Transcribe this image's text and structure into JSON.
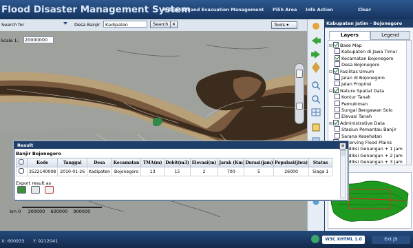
{
  "header": {
    "title": "Flood Disaster Management System",
    "nav": [
      {
        "label": "- Mitigation and Evacuation Management"
      },
      {
        "label": "Pilih Area"
      },
      {
        "label": "Info Action"
      },
      {
        "label": "Clear"
      }
    ]
  },
  "toolbar": {
    "search_label": "Search for",
    "layer_label": "Desa Banjir",
    "search_value": "Kadipaten",
    "search_button": "Search",
    "close_glyph": "✕",
    "tools_label": "Tools ▾"
  },
  "map": {
    "scale_label": "Scale 1:",
    "scale_value": "20000000",
    "km_label": "km 0",
    "km_ticks": [
      "300000",
      "600000",
      "900000"
    ]
  },
  "side_panel": {
    "title": "Kabupaten Jatim - Bojonegoro",
    "tabs": [
      {
        "label": "Layers"
      },
      {
        "label": "Legend"
      }
    ],
    "tree": [
      {
        "label": "Base Map",
        "level": 0,
        "checked": true
      },
      {
        "label": "Kabupaten di Jawa Timur",
        "level": 1,
        "checked": false
      },
      {
        "label": "Kecamatan Bojonegoro",
        "level": 1,
        "checked": true
      },
      {
        "label": "Desa Bojonegoro",
        "level": 1,
        "checked": false
      },
      {
        "label": "Fasilitas Umum",
        "level": 0,
        "checked": true
      },
      {
        "label": "Jalan di Bojonegoro",
        "level": 1,
        "checked": false
      },
      {
        "label": "Jalan Propinsi",
        "level": 1,
        "checked": false
      },
      {
        "label": "Nature Spatial Data",
        "level": 0,
        "checked": true
      },
      {
        "label": "Kontur Tanah",
        "level": 1,
        "checked": false
      },
      {
        "label": "Pemukiman",
        "level": 1,
        "checked": false
      },
      {
        "label": "Sungai Bengawan Solo",
        "level": 1,
        "checked": false
      },
      {
        "label": "Elevasi Tanah",
        "level": 1,
        "checked": false
      },
      {
        "label": "Administrative Data",
        "level": 0,
        "checked": true
      },
      {
        "label": "Stasiun Pemantau Banjir",
        "level": 1,
        "checked": false
      },
      {
        "label": "Sarana Kesehatan",
        "level": 1,
        "checked": false
      },
      {
        "label": "Preserving Flood Plains",
        "level": 0,
        "checked": true
      },
      {
        "label": "Prediksi Genangan + 1 Jam",
        "level": 1,
        "checked": false
      },
      {
        "label": "Prediksi Genangan + 2 Jam",
        "level": 1,
        "checked": false
      },
      {
        "label": "Prediksi Genangan + 3 Jam",
        "level": 1,
        "checked": false
      }
    ]
  },
  "result": {
    "title": "Result",
    "subtitle": "Banjir Bojonegoro",
    "columns": [
      "",
      "Kode",
      "Tanggal",
      "Desa",
      "Kecamatan",
      "TMA(m)",
      "Debit(m3)",
      "Elevasi(m)",
      "Jarak (Km)",
      "Durasi(jam)",
      "Populasi(jiwa)",
      "Status"
    ],
    "rows": [
      [
        "",
        "3522140008",
        "2010-01-26",
        "Kadipaten",
        "Bojonegoro",
        "13",
        "15",
        "2",
        "700",
        "5",
        "26000",
        "Siaga 1"
      ]
    ],
    "export_label": "Export result as"
  },
  "status_bar": {
    "x_coord": "X: 600933",
    "y_coord": "Y: 9212041",
    "badges": [
      "W3C XHTML 1.0",
      "Ext JS"
    ]
  },
  "colors": {
    "header_bg": "#1f3f68",
    "map_bg": "#9fa19c",
    "flood_dark": "#3c2c1e",
    "flood_mid": "#7a5a3e",
    "flood_light": "#b8a078",
    "minimap_green": "#1e9a1e"
  }
}
